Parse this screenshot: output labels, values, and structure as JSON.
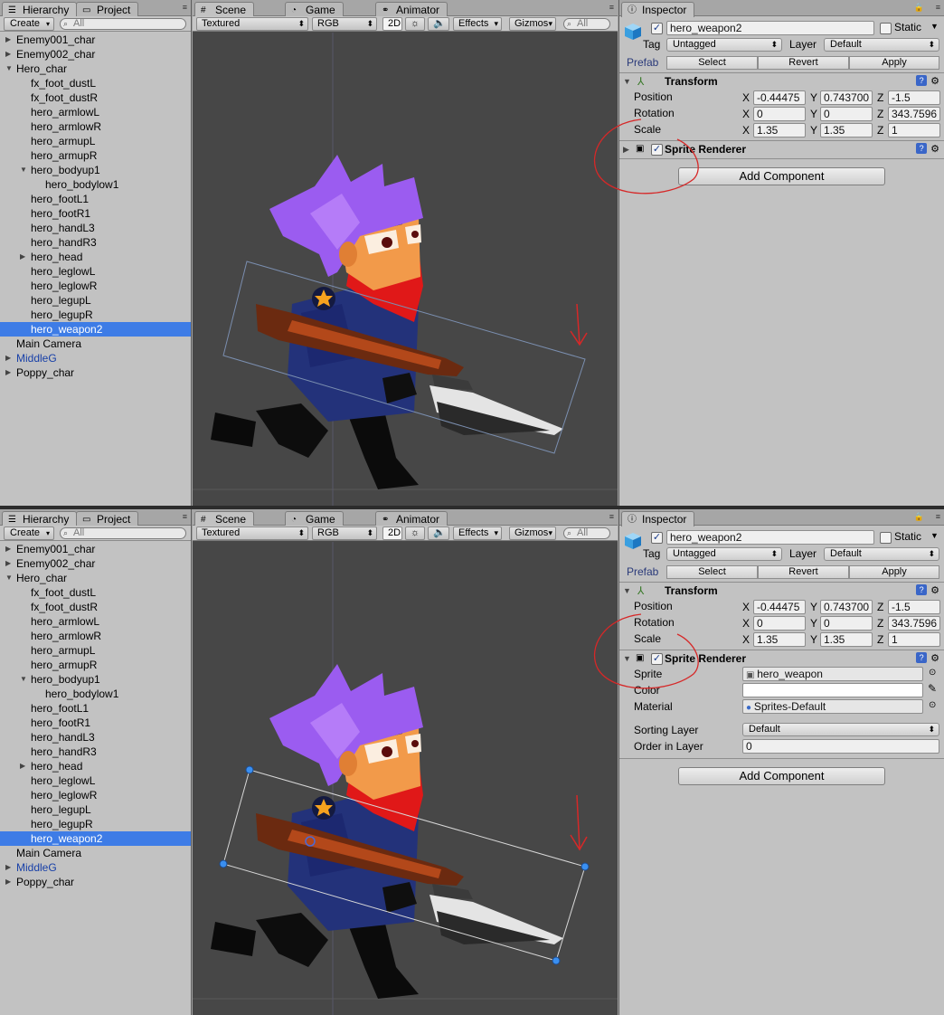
{
  "tabs": {
    "hierarchy": "Hierarchy",
    "project": "Project",
    "scene": "Scene",
    "game": "Game",
    "animator": "Animator",
    "inspector": "Inspector"
  },
  "hierarchy": {
    "create_label": "Create",
    "search_placeholder": "All",
    "items": [
      {
        "label": "Enemy001_char",
        "depth": 0,
        "fold": "collapsed"
      },
      {
        "label": "Enemy002_char",
        "depth": 0,
        "fold": "collapsed"
      },
      {
        "label": "Hero_char",
        "depth": 0,
        "fold": "expanded"
      },
      {
        "label": "fx_foot_dustL",
        "depth": 1,
        "fold": "none"
      },
      {
        "label": "fx_foot_dustR",
        "depth": 1,
        "fold": "none"
      },
      {
        "label": "hero_armlowL",
        "depth": 1,
        "fold": "none"
      },
      {
        "label": "hero_armlowR",
        "depth": 1,
        "fold": "none"
      },
      {
        "label": "hero_armupL",
        "depth": 1,
        "fold": "none"
      },
      {
        "label": "hero_armupR",
        "depth": 1,
        "fold": "none"
      },
      {
        "label": "hero_bodyup1",
        "depth": 1,
        "fold": "expanded"
      },
      {
        "label": "hero_bodylow1",
        "depth": 2,
        "fold": "none"
      },
      {
        "label": "hero_footL1",
        "depth": 1,
        "fold": "none"
      },
      {
        "label": "hero_footR1",
        "depth": 1,
        "fold": "none"
      },
      {
        "label": "hero_handL3",
        "depth": 1,
        "fold": "none"
      },
      {
        "label": "hero_handR3",
        "depth": 1,
        "fold": "none"
      },
      {
        "label": "hero_head",
        "depth": 1,
        "fold": "collapsed"
      },
      {
        "label": "hero_leglowL",
        "depth": 1,
        "fold": "none"
      },
      {
        "label": "hero_leglowR",
        "depth": 1,
        "fold": "none"
      },
      {
        "label": "hero_legupL",
        "depth": 1,
        "fold": "none"
      },
      {
        "label": "hero_legupR",
        "depth": 1,
        "fold": "none"
      },
      {
        "label": "hero_weapon2",
        "depth": 1,
        "fold": "none",
        "selected": true
      },
      {
        "label": "Main Camera",
        "depth": 0,
        "fold": "none"
      },
      {
        "label": "MiddleG",
        "depth": 0,
        "fold": "collapsed",
        "prefab": true
      },
      {
        "label": "Poppy_char",
        "depth": 0,
        "fold": "collapsed"
      }
    ]
  },
  "scene_toolbar": {
    "draw_mode": "Textured",
    "render_mode": "RGB",
    "mode_2d": "2D",
    "effects": "Effects",
    "gizmos": "Gizmos",
    "search_placeholder": "All"
  },
  "inspector": {
    "object_name": "hero_weapon2",
    "static_label": "Static",
    "tag_label": "Tag",
    "tag_value": "Untagged",
    "layer_label": "Layer",
    "layer_value": "Default",
    "prefab_label": "Prefab",
    "select_label": "Select",
    "revert_label": "Revert",
    "apply_label": "Apply",
    "transform": {
      "title": "Transform",
      "position_label": "Position",
      "rotation_label": "Rotation",
      "scale_label": "Scale",
      "position": {
        "x": "-0.44475",
        "y": "0.743700",
        "z": "-1.5"
      },
      "rotation": {
        "x": "0",
        "y": "0",
        "z": "343.7596"
      },
      "scale": {
        "x": "1.35",
        "y": "1.35",
        "z": "1"
      }
    },
    "sprite_renderer": {
      "title": "Sprite Renderer",
      "sprite_label": "Sprite",
      "sprite_value": "hero_weapon",
      "color_label": "Color",
      "material_label": "Material",
      "material_value": "Sprites-Default",
      "sorting_layer_label": "Sorting Layer",
      "sorting_layer_value": "Default",
      "order_label": "Order in Layer",
      "order_value": "0"
    },
    "add_component_label": "Add Component"
  },
  "axis": {
    "x": "X",
    "y": "Y",
    "z": "Z"
  },
  "colors": {
    "selection": "#3e7ce6",
    "annotation": "#d62828",
    "handle": "#3a8ff0",
    "hair": "#9b5cf0",
    "skin": "#f29a4a",
    "scarf": "#e01818",
    "suit": "#23327a"
  },
  "icons": {
    "hierarchy": "list-icon",
    "project": "folder-icon",
    "scene": "grid-icon",
    "game": "pacman-icon",
    "animator": "nodes-icon",
    "inspector": "info-icon",
    "gameobject": "cube-icon",
    "transform": "axes-icon",
    "settings": "gear-icon",
    "help": "help-icon"
  }
}
